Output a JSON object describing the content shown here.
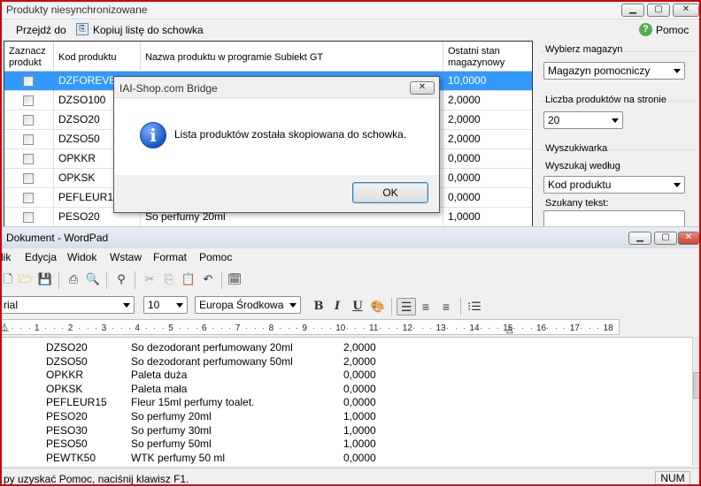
{
  "window1": {
    "title": "Produkty niesynchronizowane",
    "btn_min": "▁",
    "btn_max": "▢",
    "btn_close": "✕",
    "menu": {
      "goto": "Przejdź do",
      "copy": "Kopiuj listę do schowka",
      "help": "Pomoc"
    },
    "grid": {
      "headers": [
        "Zaznacz produkt",
        "Kod produktu",
        "Nazwa produktu w programie Subiekt GT",
        "Ostatni stan magazynowy"
      ],
      "rows": [
        {
          "code": "DZFOREVER",
          "name": "",
          "stock": "10,0000"
        },
        {
          "code": "DZSO100",
          "name": "",
          "stock": "2,0000"
        },
        {
          "code": "DZSO20",
          "name": "",
          "stock": "2,0000"
        },
        {
          "code": "DZSO50",
          "name": "",
          "stock": "2,0000"
        },
        {
          "code": "OPKKR",
          "name": "",
          "stock": "0,0000"
        },
        {
          "code": "OPKSK",
          "name": "",
          "stock": "0,0000"
        },
        {
          "code": "PEFLEUR15",
          "name": "",
          "stock": "0,0000"
        },
        {
          "code": "PESO20",
          "name": "So perfumy 20ml",
          "stock": "1,0000"
        }
      ]
    },
    "panel": {
      "warehouse_label": "Wybierz  magazyn",
      "warehouse_value": "Magazyn pomocniczy",
      "per_page_label": "Liczba produktów na stronie",
      "per_page_value": "20",
      "search_group": "Wyszukiwarka",
      "search_by_label": "Wyszukaj według",
      "search_by_value": "Kod produktu",
      "search_text_label": "Szukany tekst:"
    }
  },
  "dialog": {
    "title": "IAI-Shop.com Bridge",
    "close": "✕",
    "message": "Lista produktów została skopiowana do schowka.",
    "ok": "OK"
  },
  "wordpad": {
    "title": "Dokument - WordPad",
    "btn_min": "▁",
    "btn_max": "▢",
    "btn_close": "✕",
    "menu": [
      "lik",
      "Edycja",
      "Widok",
      "Wstaw",
      "Format",
      "Pomoc"
    ],
    "font_name": "rial",
    "font_size": "10",
    "script": "Europa Środkowa",
    "bold": "B",
    "italic": "I",
    "underline": "U",
    "ruler_numbers": [
      "1",
      "2",
      "3",
      "4",
      "5",
      "6",
      "7",
      "8",
      "9",
      "10",
      "11",
      "12",
      "13",
      "14",
      "15",
      "16",
      "17",
      "18"
    ],
    "lines": [
      {
        "code": "DZSO20",
        "name": "So dezodorant perfumowany 20ml",
        "qty": "2,0000"
      },
      {
        "code": "DZSO50",
        "name": "So dezodorant perfumowany 50ml",
        "qty": "2,0000"
      },
      {
        "code": "OPKKR",
        "name": "Paleta duża",
        "qty": "0,0000"
      },
      {
        "code": "OPKSK",
        "name": "Paleta mała",
        "qty": "0,0000"
      },
      {
        "code": "PEFLEUR15",
        "name": "Fleur 15ml perfumy toalet.",
        "qty": "0,0000"
      },
      {
        "code": "PESO20",
        "name": "So perfumy 20ml",
        "qty": "1,0000"
      },
      {
        "code": "PESO30",
        "name": "So perfumy 30ml",
        "qty": "1,0000"
      },
      {
        "code": "PESO50",
        "name": "So perfumy 50ml",
        "qty": "1,0000"
      },
      {
        "code": "PEWTK50",
        "name": "WTK perfumy 50 ml",
        "qty": "0,0000"
      }
    ],
    "status": "py uzyskać Pomoc, naciśnij klawisz F1.",
    "num": "NUM"
  }
}
